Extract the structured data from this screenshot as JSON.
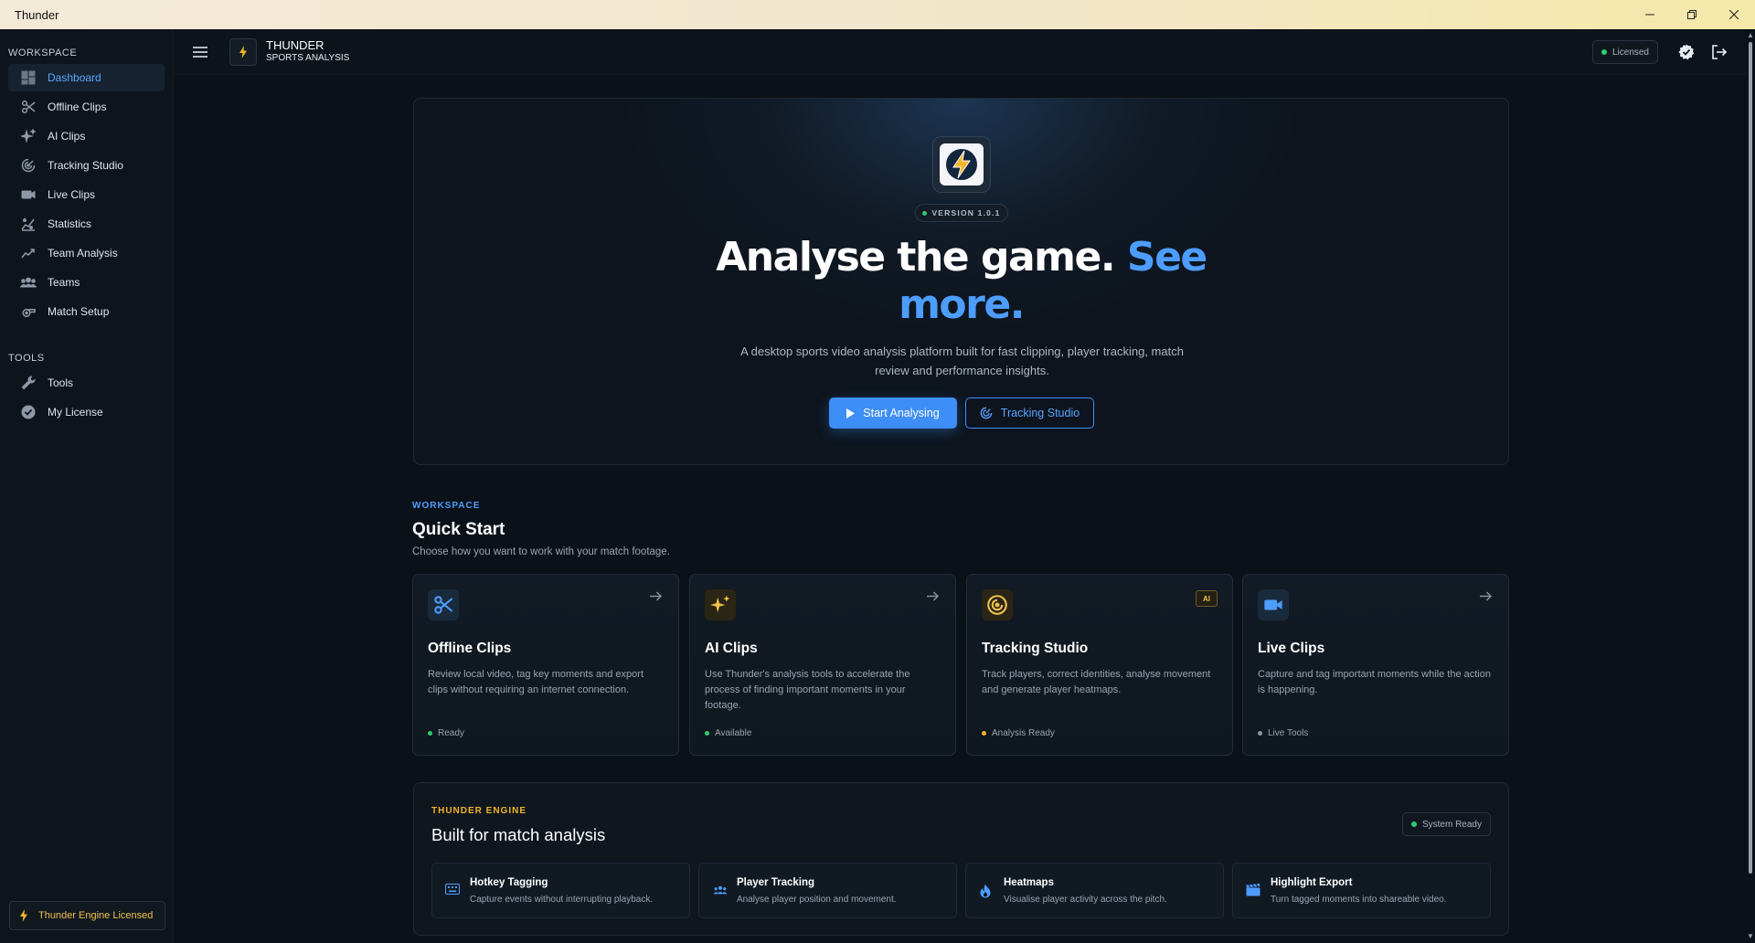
{
  "window": {
    "title": "Thunder"
  },
  "sidebar": {
    "workspace_label": "WORKSPACE",
    "workspace_items": [
      {
        "label": "Dashboard",
        "icon": "dashboard-icon",
        "active": true
      },
      {
        "label": "Offline Clips",
        "icon": "scissors-icon"
      },
      {
        "label": "AI Clips",
        "icon": "sparkles-icon"
      },
      {
        "label": "Tracking Studio",
        "icon": "radar-icon"
      },
      {
        "label": "Live Clips",
        "icon": "video-camera-icon"
      },
      {
        "label": "Statistics",
        "icon": "scatter-chart-icon"
      },
      {
        "label": "Team Analysis",
        "icon": "line-chart-icon"
      },
      {
        "label": "Teams",
        "icon": "group-icon"
      },
      {
        "label": "Match Setup",
        "icon": "whistle-icon"
      }
    ],
    "tools_label": "TOOLS",
    "tools_items": [
      {
        "label": "Tools",
        "icon": "wrench-icon"
      },
      {
        "label": "My License",
        "icon": "verified-badge-icon"
      }
    ],
    "license_badge": "Thunder Engine Licensed"
  },
  "topbar": {
    "brand_name": "THUNDER",
    "brand_sub": "SPORTS ANALYSIS",
    "license_status": "Licensed"
  },
  "hero": {
    "version": "VERSION 1.0.1",
    "headline_main": "Analyse the game.",
    "headline_accent_1": "See",
    "headline_accent_2": "more.",
    "subtitle": "A desktop sports video analysis platform built for fast clipping, player tracking, match review and performance insights.",
    "primary_button": "Start Analysing",
    "secondary_button": "Tracking Studio"
  },
  "quick_start": {
    "label": "WORKSPACE",
    "title": "Quick Start",
    "subtitle": "Choose how you want to work with your match footage.",
    "cards": [
      {
        "title": "Offline Clips",
        "description": "Review local video, tag key moments and export clips without requiring an internet connection.",
        "status": "Ready",
        "status_color": "#2ecc71"
      },
      {
        "title": "AI Clips",
        "description": "Use Thunder's analysis tools to accelerate the process of finding important moments in your footage.",
        "status": "Available",
        "status_color": "#2ecc71"
      },
      {
        "title": "Tracking Studio",
        "description": "Track players, correct identities, analyse movement and generate player heatmaps.",
        "status": "Analysis Ready",
        "status_color": "#f0b429",
        "tag": "AI"
      },
      {
        "title": "Live Clips",
        "description": "Capture and tag important moments while the action is happening.",
        "status": "Live Tools",
        "status_color": "#8a95a3"
      }
    ]
  },
  "engine": {
    "label": "THUNDER ENGINE",
    "title": "Built for match analysis",
    "status": "System Ready",
    "features": [
      {
        "title": "Hotkey Tagging",
        "description": "Capture events without interrupting playback."
      },
      {
        "title": "Player Tracking",
        "description": "Analyse player position and movement."
      },
      {
        "title": "Heatmaps",
        "description": "Visualise player activity across the pitch."
      },
      {
        "title": "Highlight Export",
        "description": "Turn tagged moments into shareable video."
      }
    ]
  },
  "colors": {
    "accent": "#4d9dff",
    "gold": "#f0b429",
    "background": "#0b1118"
  }
}
